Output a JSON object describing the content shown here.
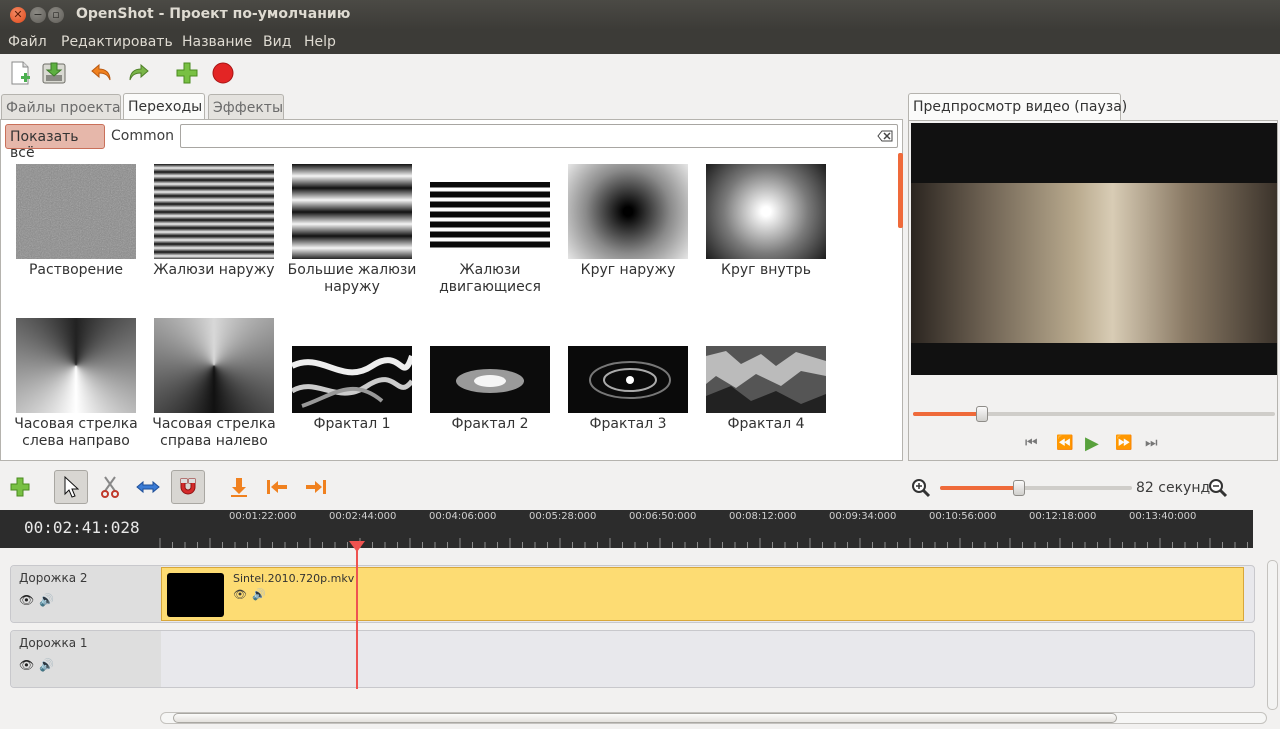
{
  "window": {
    "title": "OpenShot - Проект по-умолчанию"
  },
  "menu": [
    "Файл",
    "Редактировать",
    "Название",
    "Вид",
    "Help"
  ],
  "toolbar": {
    "icons": [
      "new-project-icon",
      "save-project-icon",
      "undo-icon",
      "redo-icon",
      "import-files-icon",
      "record-icon"
    ]
  },
  "left_tabs": [
    "Файлы проекта",
    "Переходы",
    "Эффекты"
  ],
  "active_tab": "Переходы",
  "filter": {
    "show_all_label": "Показать всё",
    "common_label": "Common",
    "search_value": ""
  },
  "transitions": [
    {
      "label": "Растворение"
    },
    {
      "label": "Жалюзи наружу"
    },
    {
      "label": "Большие жалюзи наружу"
    },
    {
      "label": "Жалюзи двигающиеся"
    },
    {
      "label": "Круг наружу"
    },
    {
      "label": "Круг внутрь"
    },
    {
      "label": "Часовая стрелка слева направо"
    },
    {
      "label": "Часовая стрелка справа налево"
    },
    {
      "label": "Фрактал 1"
    },
    {
      "label": "Фрактал 2"
    },
    {
      "label": "Фрактал 3"
    },
    {
      "label": "Фрактал 4"
    }
  ],
  "preview": {
    "tab_label": "Предпросмотр видео (пауза)",
    "position_fraction": 0.19
  },
  "timeline": {
    "zoom_label": "82 секунд",
    "zoom_fraction": 0.41,
    "timecode": "00:02:41:028",
    "ruler_labels": [
      "00:01:22:000",
      "00:02:44:000",
      "00:04:06:000",
      "00:05:28:000",
      "00:06:50:000",
      "00:08:12:000",
      "00:09:34:000",
      "00:10:56:000",
      "00:12:18:000",
      "00:13:40:000"
    ],
    "tracks": [
      {
        "name": "Дорожка 2",
        "clip": "Sintel.2010.720p.mkv"
      },
      {
        "name": "Дорожка 1",
        "clip": ""
      }
    ]
  }
}
